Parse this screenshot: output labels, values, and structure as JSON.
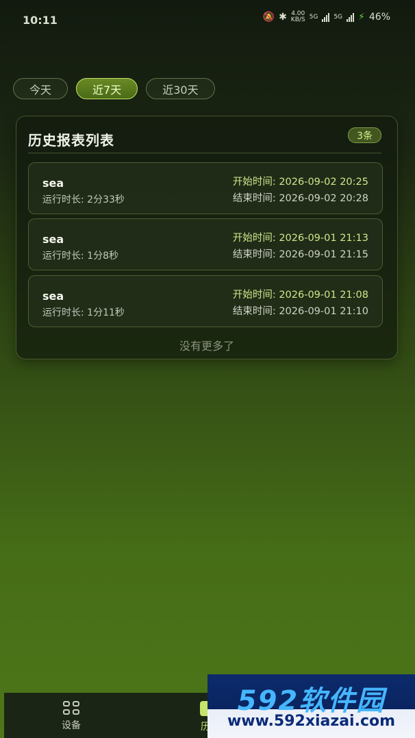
{
  "status_bar": {
    "time": "10:11",
    "speed_value": "4.00",
    "speed_unit": "KB/S",
    "net_label_1": "5G",
    "net_label_2": "5G",
    "battery": "46%"
  },
  "filters": [
    {
      "label": "今天",
      "active": false
    },
    {
      "label": "近7天",
      "active": true
    },
    {
      "label": "近30天",
      "active": false
    }
  ],
  "panel": {
    "title": "历史报表列表",
    "count_badge": "3条",
    "empty_hint": "没有更多了"
  },
  "records": [
    {
      "name": "sea",
      "duration": "运行时长: 2分33秒",
      "start": "开始时间: 2026-09-02 20:25",
      "end": "结束时间: 2026-09-02 20:28"
    },
    {
      "name": "sea",
      "duration": "运行时长: 1分8秒",
      "start": "开始时间: 2026-09-01 21:13",
      "end": "结束时间: 2026-09-01 21:15"
    },
    {
      "name": "sea",
      "duration": "运行时长: 1分11秒",
      "start": "开始时间: 2026-09-01 21:08",
      "end": "结束时间: 2026-09-01 21:10"
    }
  ],
  "bottom_nav": [
    {
      "label": "设备",
      "icon": "grid-icon",
      "active": false
    },
    {
      "label": "历",
      "icon": "history-icon",
      "active": true
    }
  ],
  "watermark": {
    "logo": "592软件园",
    "url": "www.592xiazai.com"
  },
  "colors": {
    "accent": "#c6e36a",
    "start_time": "#cfe88c"
  }
}
